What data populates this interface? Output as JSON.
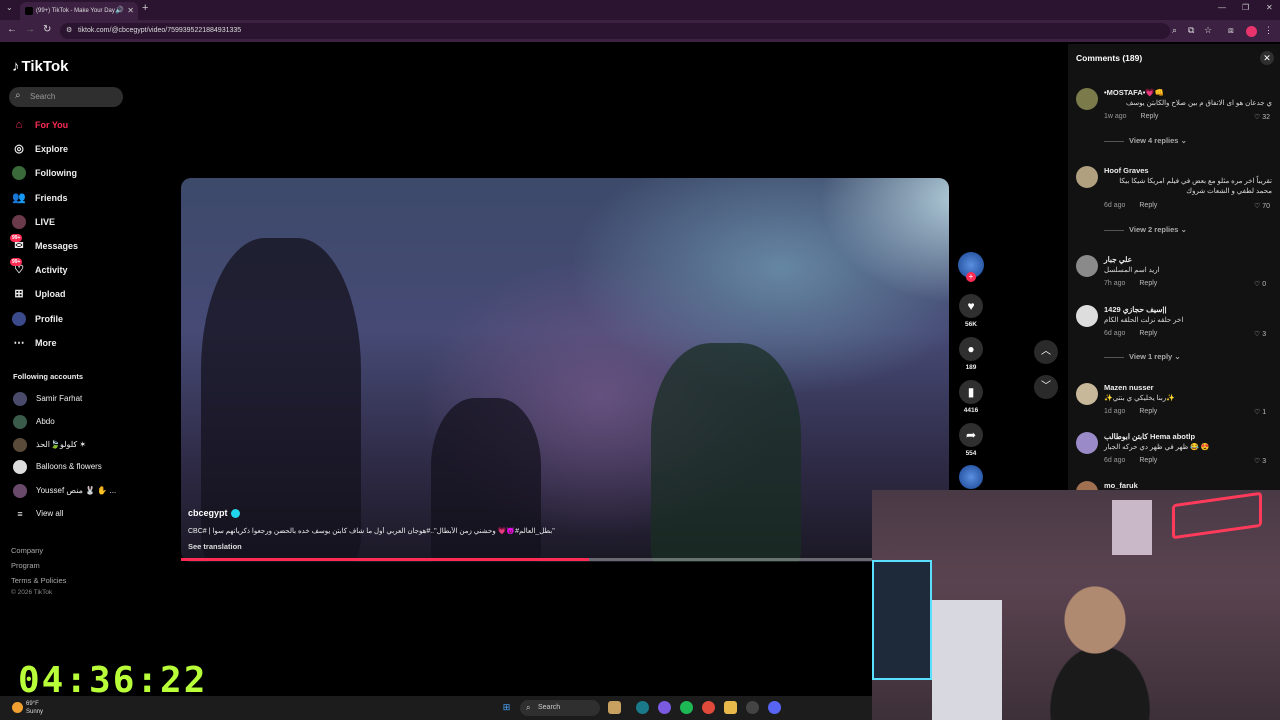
{
  "browser": {
    "tab_title": "(99+) TikTok - Make Your Day",
    "url": "tiktok.com/@cbcegypt/video/7599395221884931335"
  },
  "sidebar": {
    "logo": "TikTok",
    "search_placeholder": "Search",
    "nav": [
      {
        "label": "For You",
        "icon": "home-icon",
        "active": true
      },
      {
        "label": "Explore",
        "icon": "compass-icon"
      },
      {
        "label": "Following",
        "icon": "following-avatar-icon"
      },
      {
        "label": "Friends",
        "icon": "friends-icon"
      },
      {
        "label": "LIVE",
        "icon": "live-icon"
      },
      {
        "label": "Messages",
        "icon": "messages-icon",
        "badge": "99+"
      },
      {
        "label": "Activity",
        "icon": "activity-icon",
        "badge": "99+"
      },
      {
        "label": "Upload",
        "icon": "upload-icon"
      },
      {
        "label": "Profile",
        "icon": "profile-avatar-icon"
      },
      {
        "label": "More",
        "icon": "more-icon"
      }
    ],
    "following_heading": "Following accounts",
    "following": [
      {
        "name": "Samir Farhat"
      },
      {
        "name": "Abdo"
      },
      {
        "name": "كلولو🍃الحذ ✶"
      },
      {
        "name": "Balloons & flowers"
      },
      {
        "name": "Youssef منص 🐰 ✋ ..."
      }
    ],
    "view_all": "View all",
    "footer": [
      "Company",
      "Program",
      "Terms & Policies",
      "© 2026 TikTok"
    ]
  },
  "video": {
    "creator": "cbcegypt",
    "caption": "CBC# | بطل_العالم#😈💗 وحشني زمن الأبطال\"..#هوجان العربي أول ما شاف كابتن يوسف خده بالحضن ورجعوا ذكرياتهم سوا\"",
    "see_translation": "See translation",
    "progress": 0.59
  },
  "actions": {
    "likes": "56K",
    "comments": "189",
    "saves": "4416",
    "shares": "554"
  },
  "comments": {
    "title": "Comments",
    "count": "(189)",
    "items": [
      {
        "name": "•MOSTAFA•💗👊",
        "text": "ي جدعان هو اى الاتفاق م بين صلاح والكابتن يوسف",
        "time": "1w ago",
        "reply": "Reply",
        "likes": "32",
        "view_replies": "View 4 replies"
      },
      {
        "name": "Hoof Graves",
        "text": "تقريباً اخر مره مثلو مع بعض في فيلم امريكا شيكا بيكا محمد لطفي و الشعات شروك",
        "time": "6d ago",
        "reply": "Reply",
        "likes": "70",
        "view_replies": "View 2 replies"
      },
      {
        "name": "علي جبار",
        "text": "اريد اسم المسلسل",
        "time": "7h ago",
        "reply": "Reply",
        "likes": "0"
      },
      {
        "name": "سيف حجازي 1429||",
        "text": "اخر حلقه نزلت الحلقه الكام",
        "time": "6d ago",
        "reply": "Reply",
        "likes": "3",
        "view_replies": "View 1 reply"
      },
      {
        "name": "Mazen nusser",
        "text": "✨ربنا يخليكي ي بنتي✨",
        "time": "1d ago",
        "reply": "Reply",
        "likes": "1"
      },
      {
        "name": "كابتن ابوطالب Hema abotlp",
        "text": "😍 😂 ظهر في ظهر دي حركه الجبار",
        "time": "6d ago",
        "reply": "Reply",
        "likes": "3"
      },
      {
        "name": "mo_faruk",
        "text": "",
        "time": "",
        "reply": "",
        "likes": ""
      }
    ]
  },
  "overlay": {
    "clock": "04:36:22"
  },
  "taskbar": {
    "weather_temp": "69°F",
    "weather_desc": "Sunny",
    "search": "Search"
  },
  "colors": {
    "accent": "#fe2c55",
    "clock": "#b8ff3a",
    "chrome": "#3c2142"
  }
}
